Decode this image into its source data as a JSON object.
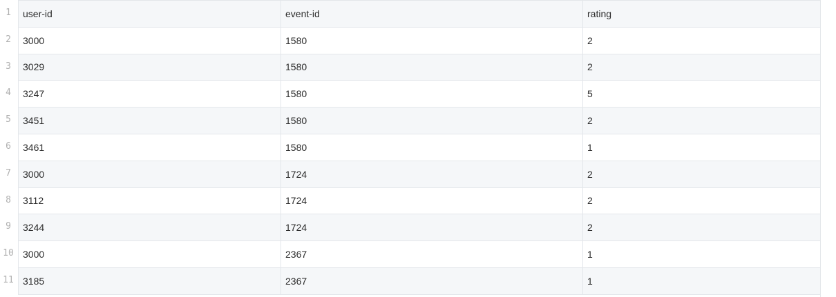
{
  "row_numbers": [
    "1",
    "2",
    "3",
    "4",
    "5",
    "6",
    "7",
    "8",
    "9",
    "10",
    "11"
  ],
  "table": {
    "columns": [
      "user-id",
      "event-id",
      "rating"
    ],
    "rows": [
      [
        "3000",
        "1580",
        "2"
      ],
      [
        "3029",
        "1580",
        "2"
      ],
      [
        "3247",
        "1580",
        "5"
      ],
      [
        "3451",
        "1580",
        "2"
      ],
      [
        "3461",
        "1580",
        "1"
      ],
      [
        "3000",
        "1724",
        "2"
      ],
      [
        "3112",
        "1724",
        "2"
      ],
      [
        "3244",
        "1724",
        "2"
      ],
      [
        "3000",
        "2367",
        "1"
      ],
      [
        "3185",
        "2367",
        "1"
      ]
    ]
  }
}
